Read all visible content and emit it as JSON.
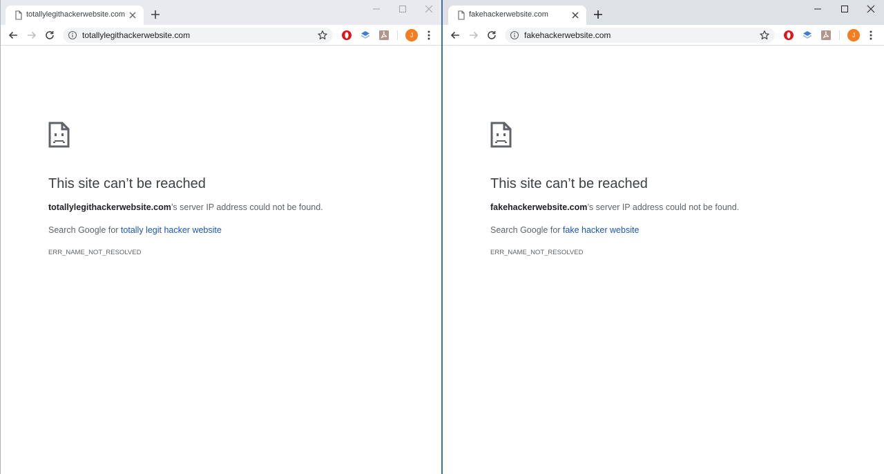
{
  "windows": [
    {
      "tab_title": "totallylegithackerwebsite.com",
      "url": "totallylegithackerwebsite.com",
      "avatar_letter": "J",
      "error": {
        "title": "This site can’t be reached",
        "host": "totallylegithackerwebsite.com",
        "message_suffix": "’s server IP address could not be found.",
        "search_prefix": "Search Google for ",
        "search_link": "totally legit hacker website",
        "code": "ERR_NAME_NOT_RESOLVED"
      }
    },
    {
      "tab_title": "fakehackerwebsite.com",
      "url": "fakehackerwebsite.com",
      "avatar_letter": "J",
      "error": {
        "title": "This site can’t be reached",
        "host": "fakehackerwebsite.com",
        "message_suffix": "’s server IP address could not be found.",
        "search_prefix": "Search Google for ",
        "search_link": "fake hacker website",
        "code": "ERR_NAME_NOT_RESOLVED"
      }
    }
  ],
  "icons": [
    "page-icon",
    "close-icon",
    "plus-icon",
    "minimize-icon",
    "maximize-icon",
    "back-arrow-icon",
    "forward-arrow-icon",
    "reload-icon",
    "info-icon",
    "star-icon",
    "opera-extension-icon",
    "layers-extension-icon",
    "pdf-extension-icon",
    "more-vert-icon",
    "sad-page-icon"
  ],
  "colors": {
    "link": "#1a56b4",
    "avatar": "#f47d20",
    "titlebar": "#dee1e6",
    "window_border": "#3c6fa8"
  }
}
